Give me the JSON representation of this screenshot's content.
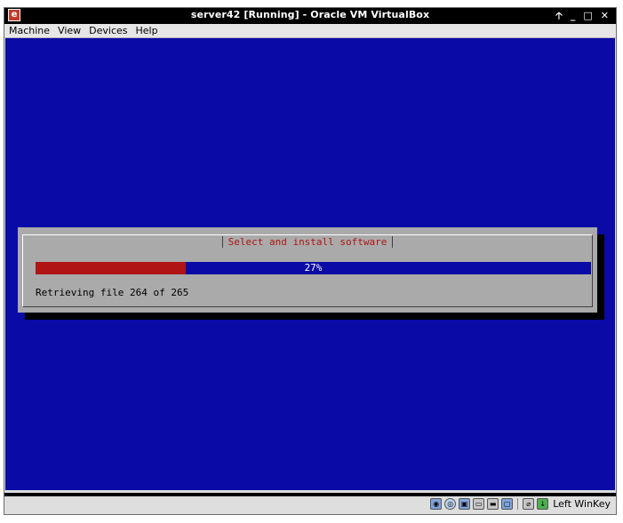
{
  "window": {
    "title": "server42 [Running] - Oracle VM VirtualBox",
    "controls": [
      "🡡",
      "_",
      "□",
      "✕"
    ]
  },
  "menu": {
    "items": [
      "Machine",
      "View",
      "Devices",
      "Help"
    ]
  },
  "installer": {
    "dialog_title": "Select and install software",
    "progress_percent": 27,
    "progress_label": "27%",
    "status_message": "Retrieving file 264 of 265"
  },
  "statusbar": {
    "icons": [
      "harddisk-icon",
      "optical-drive-icon",
      "network-icon",
      "shared-folders-icon",
      "display-icon",
      "capture-icon",
      "mouse-integration-icon",
      "host-key-icon"
    ],
    "host_key": "Left WinKey"
  },
  "colors": {
    "screen_bg": "#0a0aa6",
    "dialog_bg": "#aaaaaa",
    "progress_fill": "#b01414",
    "progress_track": "#0a0aa6",
    "dialog_title": "#b01414"
  }
}
